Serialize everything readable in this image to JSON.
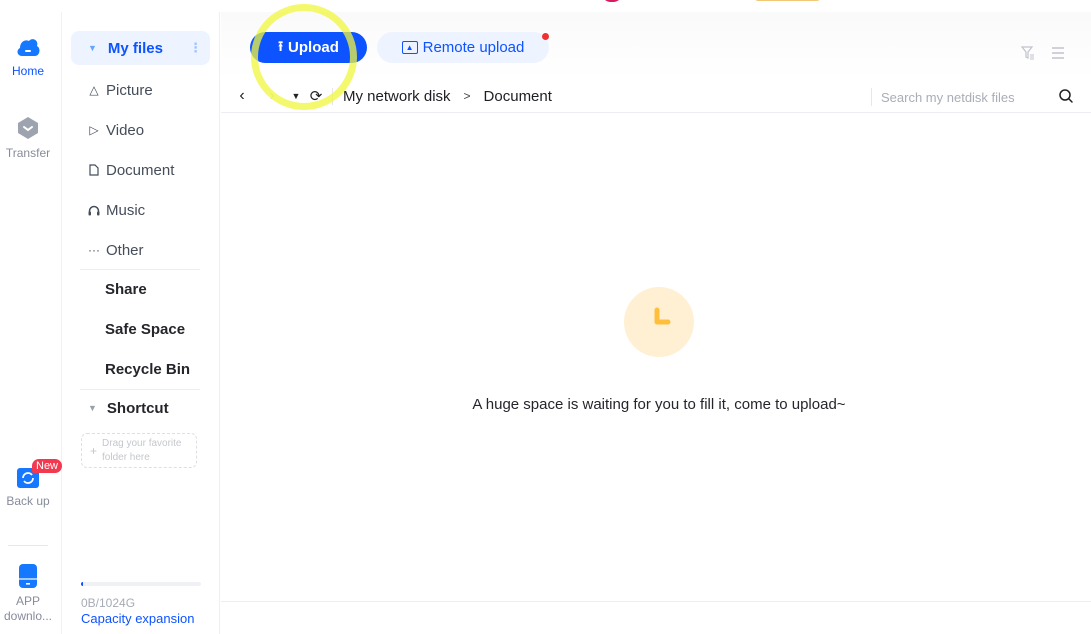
{
  "rail": {
    "items": [
      {
        "label": "Home",
        "icon": "cloud-icon",
        "active": true
      },
      {
        "label": "Transfer",
        "icon": "transfer-icon",
        "active": false
      },
      {
        "label": "Back up",
        "icon": "backup-icon",
        "badge": "New"
      },
      {
        "label": "APP downlo...",
        "icon": "phone-icon"
      }
    ]
  },
  "sidebar": {
    "my_files": "My files",
    "categories": [
      {
        "label": "Picture",
        "icon": "picture-icon"
      },
      {
        "label": "Video",
        "icon": "video-icon"
      },
      {
        "label": "Document",
        "icon": "document-icon"
      },
      {
        "label": "Music",
        "icon": "music-icon"
      },
      {
        "label": "Other",
        "icon": "more-icon"
      }
    ],
    "sections": [
      "Share",
      "Safe Space",
      "Recycle Bin"
    ],
    "shortcut": "Shortcut",
    "dropzone": "Drag your favorite folder here",
    "capacity": {
      "used_text": "0B/1024G",
      "used_fraction": 0.01,
      "expand_link": "Capacity expansion"
    }
  },
  "toolbar": {
    "upload": "Upload",
    "remote_upload": "Remote upload"
  },
  "navbar": {
    "breadcrumb": [
      "My network disk",
      "Document"
    ],
    "search_placeholder": "Search my netdisk files"
  },
  "empty_state": {
    "message": "A huge space is waiting for you to fill it, come to upload~"
  }
}
